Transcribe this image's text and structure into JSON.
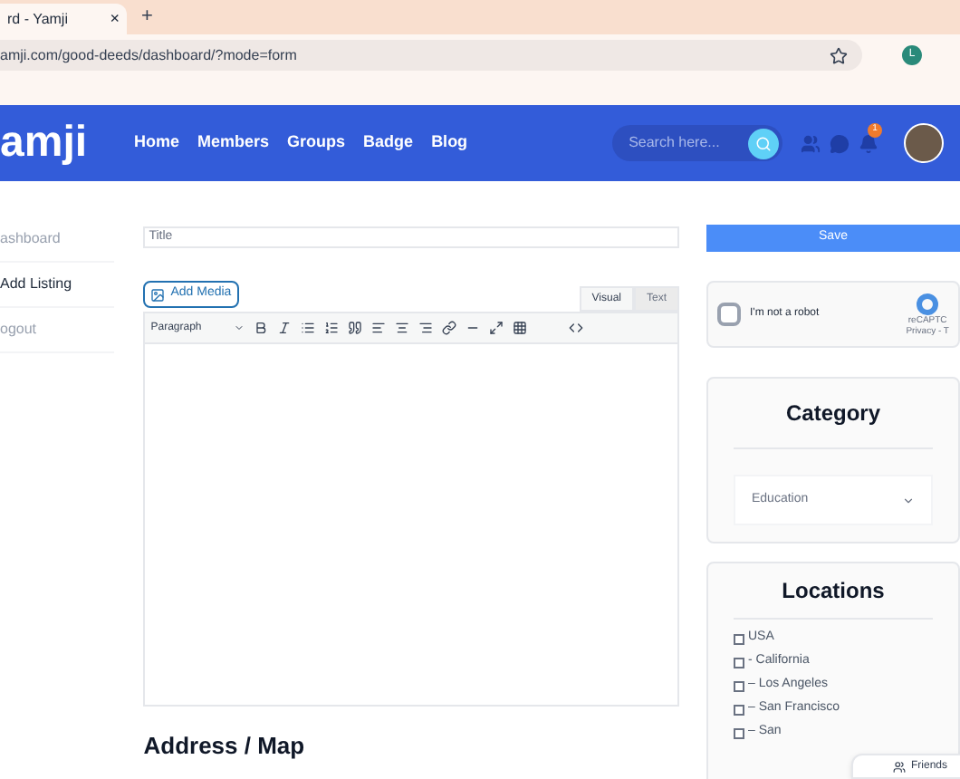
{
  "browser": {
    "tab_title": "rd - Yamji",
    "new_tab": "+",
    "close": "×",
    "url": "amji.com/good-deeds/dashboard/?mode=form",
    "profile_initial": "L"
  },
  "header": {
    "logo": "amji",
    "nav": [
      "Home",
      "Members",
      "Groups",
      "Badge",
      "Blog"
    ],
    "search": {
      "placeholder": "Search here..."
    },
    "notification_count": "1"
  },
  "sidebar": {
    "items": [
      {
        "label": "ashboard",
        "selected": false
      },
      {
        "label": "Add Listing",
        "selected": true
      },
      {
        "label": "ogout",
        "selected": false
      }
    ]
  },
  "editor": {
    "title_placeholder": "Title",
    "add_media": "Add Media",
    "tabs": [
      {
        "label": "Visual",
        "selected": true
      },
      {
        "label": "Text",
        "selected": false
      }
    ],
    "format": "Paragraph"
  },
  "address_heading": "Address / Map",
  "save": "Save",
  "captcha": {
    "label": "I'm not a robot",
    "checked": false,
    "brand": "reCAPTC",
    "links": "Privacy - T"
  },
  "category": {
    "heading": "Category",
    "value": "Education"
  },
  "locations": {
    "heading": "Locations",
    "items": [
      {
        "label": "USA",
        "checked": false
      },
      {
        "label": "- California",
        "checked": false
      },
      {
        "label": "– Los Angeles",
        "checked": false
      },
      {
        "label": "– San Francisco",
        "checked": false
      },
      {
        "label": "– San",
        "checked": false
      }
    ]
  },
  "friends_button": "Friends"
}
